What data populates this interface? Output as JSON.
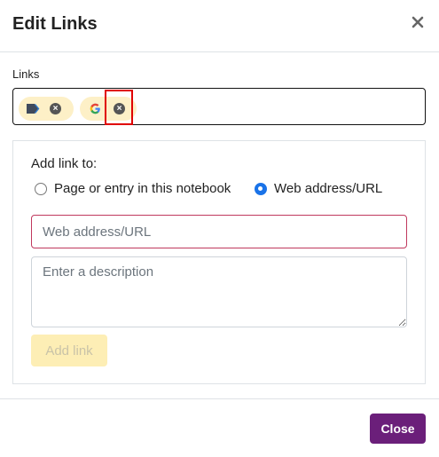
{
  "modal": {
    "title": "Edit Links",
    "close_icon": "close-icon"
  },
  "links": {
    "label": "Links",
    "chips": [
      {
        "icon": "page-link-icon",
        "remove_icon": "remove-icon"
      },
      {
        "icon": "google-icon",
        "remove_icon": "remove-icon"
      }
    ]
  },
  "add_link": {
    "heading": "Add link to:",
    "options": [
      {
        "label": "Page or entry in this notebook",
        "selected": false
      },
      {
        "label": "Web address/URL",
        "selected": true
      }
    ],
    "url_placeholder": "Web address/URL",
    "url_value": "",
    "description_placeholder": "Enter a description",
    "description_value": "",
    "button_label": "Add link"
  },
  "footer": {
    "close_label": "Close"
  },
  "colors": {
    "primary": "#6b1f7a",
    "chip": "#fdf0c7",
    "radio_accent": "#1a73e8",
    "url_border": "#c0395e",
    "highlight": "#e00000"
  }
}
